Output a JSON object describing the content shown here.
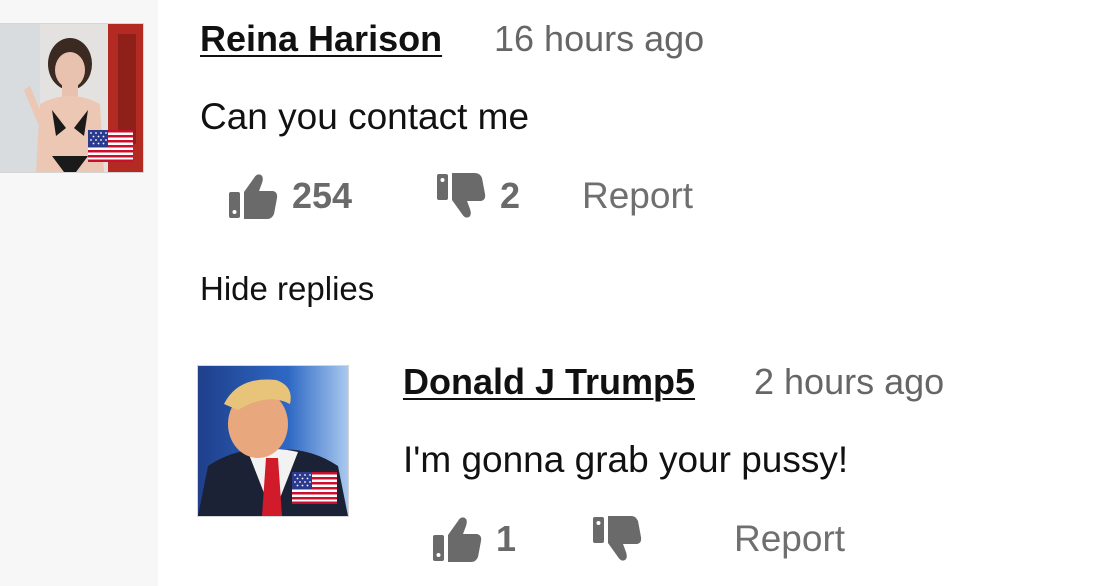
{
  "comment": {
    "author": "Reina Harison",
    "time": "16 hours ago",
    "text": "Can you contact me",
    "likes": "254",
    "dislikes": "2",
    "report_label": "Report",
    "flag": "us-flag"
  },
  "hide_replies_label": "Hide replies",
  "reply": {
    "author": "Donald J Trump5",
    "time": "2 hours ago",
    "text": "I'm gonna grab your pussy!",
    "likes": "1",
    "dislikes": "",
    "report_label": "Report",
    "flag": "us-flag"
  },
  "colors": {
    "page_bg": "#f7f7f7",
    "panel_bg": "#ffffff",
    "icon_gray": "#6a6a6a",
    "flag_red": "#c8102e",
    "flag_blue": "#2b3a8c"
  }
}
